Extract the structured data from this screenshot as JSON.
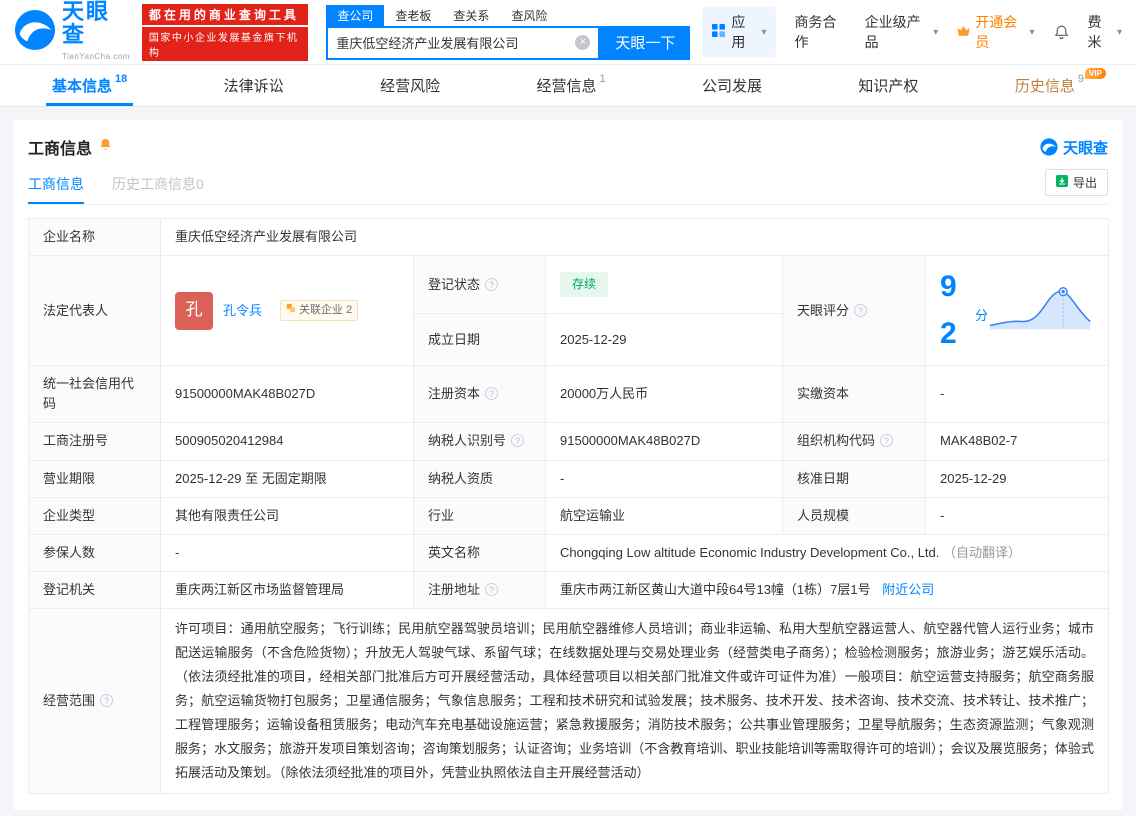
{
  "brand": {
    "name": "天眼查",
    "domain": "TianYanCha.com",
    "slogan1": "都在用的商业查询工具",
    "slogan2": "国家中小企业发展基金旗下机构"
  },
  "search": {
    "tabs": [
      {
        "label": "查公司"
      },
      {
        "label": "查老板"
      },
      {
        "label": "查关系"
      },
      {
        "label": "查风险"
      }
    ],
    "value": "重庆低空经济产业发展有限公司",
    "button": "天眼一下"
  },
  "topnav": {
    "apps": "应用",
    "business": "商务合作",
    "enterprise": "企业级产品",
    "vip": "开通会员",
    "user": "费米"
  },
  "tabs": [
    {
      "label": "基本信息",
      "count": "18"
    },
    {
      "label": "法律诉讼",
      "count": ""
    },
    {
      "label": "经营风险",
      "count": ""
    },
    {
      "label": "经营信息",
      "count": "1"
    },
    {
      "label": "公司发展",
      "count": ""
    },
    {
      "label": "知识产权",
      "count": ""
    },
    {
      "label": "历史信息",
      "count": "9",
      "vip": "VIP"
    }
  ],
  "section": {
    "title": "工商信息",
    "subtab_active": "工商信息",
    "subtab_history": "历史工商信息0",
    "export": "导出",
    "watermark": "天眼查"
  },
  "info": {
    "labels": {
      "name": "企业名称",
      "legal_rep": "法定代表人",
      "reg_status": "登记状态",
      "establish_date": "成立日期",
      "score": "天眼评分",
      "credit_code": "统一社会信用代码",
      "reg_capital": "注册资本",
      "paid_capital": "实缴资本",
      "reg_number": "工商注册号",
      "taxpayer_id": "纳税人识别号",
      "org_code": "组织机构代码",
      "business_term": "营业期限",
      "taxpayer_quality": "纳税人资质",
      "approve_date": "核准日期",
      "company_type": "企业类型",
      "industry": "行业",
      "staff_size": "人员规模",
      "insured_count": "参保人数",
      "english_name": "英文名称",
      "reg_authority": "登记机关",
      "reg_address": "注册地址",
      "business_scope": "经营范围"
    },
    "values": {
      "name": "重庆低空经济产业发展有限公司",
      "legal_rep": "孔令兵",
      "legal_rep_avatar": "孔",
      "related_badge": "关联企业 2",
      "reg_status": "存续",
      "establish_date": "2025-12-29",
      "score": "92",
      "score_unit": "分",
      "credit_code": "91500000MAK48B027D",
      "reg_capital": "20000万人民币",
      "paid_capital": "-",
      "reg_number": "500905020412984",
      "taxpayer_id": "91500000MAK48B027D",
      "org_code": "MAK48B02-7",
      "business_term": "2025-12-29 至 无固定期限",
      "taxpayer_quality": "-",
      "approve_date": "2025-12-29",
      "company_type": "其他有限责任公司",
      "industry": "航空运输业",
      "staff_size": "-",
      "insured_count": "-",
      "english_name": "Chongqing Low altitude Economic Industry Development Co., Ltd.",
      "english_name_note": "（自动翻译）",
      "reg_authority": "重庆两江新区市场监督管理局",
      "reg_address": "重庆市两江新区黄山大道中段64号13幢（1栋）7层1号",
      "nearby_link": "附近公司",
      "business_scope": "许可项目：通用航空服务；飞行训练；民用航空器驾驶员培训；民用航空器维修人员培训；商业非运输、私用大型航空器运营人、航空器代管人运行业务；城市配送运输服务（不含危险货物）；升放无人驾驶气球、系留气球；在线数据处理与交易处理业务（经营类电子商务）；检验检测服务；旅游业务；游艺娱乐活动。（依法须经批准的项目，经相关部门批准后方可开展经营活动，具体经营项目以相关部门批准文件或许可证件为准）一般项目：航空运营支持服务；航空商务服务；航空运输货物打包服务；卫星通信服务；气象信息服务；工程和技术研究和试验发展；技术服务、技术开发、技术咨询、技术交流、技术转让、技术推广；工程管理服务；运输设备租赁服务；电动汽车充电基础设施运营；紧急救援服务；消防技术服务；公共事业管理服务；卫星导航服务；生态资源监测；气象观测服务；水文服务；旅游开发项目策划咨询；咨询策划服务；认证咨询；业务培训（不含教育培训、职业技能培训等需取得许可的培训）；会议及展览服务；体验式拓展活动及策划。（除依法须经批准的项目外，凭营业执照依法自主开展经营活动）"
    }
  }
}
